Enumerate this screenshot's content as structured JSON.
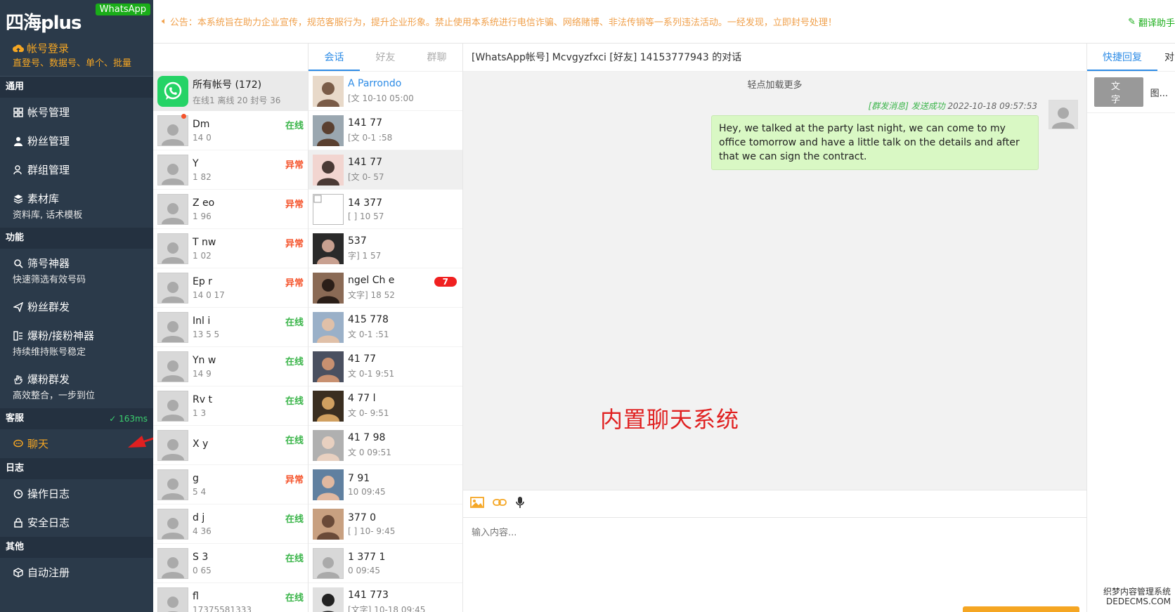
{
  "brand": {
    "title": "四海plus",
    "badge": "WhatsApp"
  },
  "sidebar": {
    "login": {
      "title": "帐号登录",
      "sub": "直登号、数据号、单个、批量"
    },
    "sections": [
      {
        "title": "通用",
        "extra": "",
        "items": [
          {
            "label": "帐号管理",
            "sub": "",
            "icon": "grid-icon"
          },
          {
            "label": "粉丝管理",
            "sub": "",
            "icon": "user-icon"
          },
          {
            "label": "群组管理",
            "sub": "",
            "icon": "group-icon"
          },
          {
            "label": "素材库",
            "sub": "资料库, 话术模板",
            "icon": "layers-icon"
          }
        ]
      },
      {
        "title": "功能",
        "extra": "",
        "items": [
          {
            "label": "筛号神器",
            "sub": "快速筛选有效号码",
            "icon": "search-icon"
          },
          {
            "label": "粉丝群发",
            "sub": "",
            "icon": "send-icon"
          },
          {
            "label": "爆粉/接粉神器",
            "sub": "持续维持账号稳定",
            "icon": "list-icon"
          },
          {
            "label": "爆粉群发",
            "sub": "高效整合，一步到位",
            "icon": "hand-icon"
          }
        ]
      },
      {
        "title": "客服",
        "extra": "✓ 163ms",
        "items": [
          {
            "label": "聊天",
            "sub": "",
            "icon": "chat-icon",
            "active": true
          }
        ]
      },
      {
        "title": "日志",
        "extra": "",
        "items": [
          {
            "label": "操作日志",
            "sub": "",
            "icon": "clock-icon"
          },
          {
            "label": "安全日志",
            "sub": "",
            "icon": "lock-icon"
          }
        ]
      },
      {
        "title": "其他",
        "extra": "",
        "items": [
          {
            "label": "自动注册",
            "sub": "",
            "icon": "cube-icon"
          }
        ]
      }
    ]
  },
  "notice": {
    "text": "公告：本系统旨在助力企业宣传，规范客服行为，提升企业形象。禁止使用本系统进行电信诈骗、网络赌博、非法传销等一系列违法活动。一经发现，立即封号处理！",
    "right": "翻译助手"
  },
  "accounts": {
    "all": {
      "title": "所有帐号 (172)",
      "sub": "在线1  离线 20 封号 36"
    },
    "rows": [
      {
        "name": "Dm",
        "num": "14          0",
        "status": "在线",
        "kind": "on",
        "dot": true
      },
      {
        "name": "Y",
        "num": "1          82",
        "status": "异常",
        "kind": "err"
      },
      {
        "name": "Z          eo",
        "num": "1          96",
        "status": "异常",
        "kind": "err"
      },
      {
        "name": "T          nw",
        "num": "1          02",
        "status": "异常",
        "kind": "err"
      },
      {
        "name": "Ep   r",
        "num": "14    0    17",
        "status": "异常",
        "kind": "err"
      },
      {
        "name": "Inl   i",
        "num": "13    5    5",
        "status": "在线",
        "kind": "on"
      },
      {
        "name": "Yn      w",
        "num": "14    9",
        "status": "在线",
        "kind": "on"
      },
      {
        "name": "Rv   t",
        "num": "1    3",
        "status": "在线",
        "kind": "on"
      },
      {
        "name": "X    y",
        "num": "",
        "status": "在线",
        "kind": "on"
      },
      {
        "name": "    g",
        "num": "    5    4",
        "status": "异常",
        "kind": "err"
      },
      {
        "name": "d    j",
        "num": "4    36",
        "status": "在线",
        "kind": "on"
      },
      {
        "name": "S    3",
        "num": "    0    65",
        "status": "在线",
        "kind": "on"
      },
      {
        "name": "    fl",
        "num": "17375581333",
        "status": "在线",
        "kind": "on"
      }
    ]
  },
  "convs": {
    "tabs": [
      "会话",
      "好友",
      "群聊"
    ],
    "rows": [
      {
        "name": "A    Parrondo",
        "sub": "[文    10-10 05:00",
        "link": true,
        "photo": "woman"
      },
      {
        "name": "141    77",
        "sub": "[文    0-1    :58",
        "photo": "man"
      },
      {
        "name": "141    77",
        "sub": "[文    0-    57",
        "photo": "child",
        "sel": true
      },
      {
        "name": "14    377",
        "sub": "[    ] 10    57",
        "photo": "broken"
      },
      {
        "name": "    537",
        "sub": "    字] 1    57",
        "photo": "dark"
      },
      {
        "name": "ngel    Ch    e",
        "sub": "文字]    18    52",
        "photo": "girl",
        "badge": "7"
      },
      {
        "name": "415    778",
        "sub": "文    0-1    :51",
        "photo": "oldman"
      },
      {
        "name": "41    77",
        "sub": "文    0-1    9:51",
        "photo": "group"
      },
      {
        "name": "4    77    l",
        "sub": "文    0-    9:51",
        "photo": "night"
      },
      {
        "name": "41    7    98",
        "sub": "文    0    09:51",
        "photo": "oldman2"
      },
      {
        "name": "    7    91",
        "sub": "    10    09:45",
        "photo": "glasses"
      },
      {
        "name": "    377    0",
        "sub": "[    ] 10-    9:45",
        "photo": "couple"
      },
      {
        "name": "1    377    1",
        "sub": "    0    09:45",
        "photo": "default"
      },
      {
        "name": "141    773",
        "sub": "[文字] 10-18 09:45",
        "photo": "cyclist"
      }
    ]
  },
  "chat": {
    "header": "[WhatsApp帐号] Mcvgyzfxci [好友] 14153777943 的对话",
    "load_more": "轻点加载更多",
    "meta_status": "[群发消息] 发送成功",
    "meta_time": "2022-10-18 09:57:53",
    "message": "Hey, we talked at the party last night, we can come to my office tomorrow and have a little talk on the details and after that we can sign the contract.",
    "watermark": "内置聊天系统",
    "input_placeholder": "输入内容..."
  },
  "quick": {
    "tabs": [
      "快捷回复",
      "对"
    ],
    "sub": [
      "文字",
      "图..."
    ]
  },
  "corner": {
    "line1": "织梦内容管理系统",
    "line2": "DEDECMS.COM"
  },
  "colors": {
    "sidebar": "#2b3a4a",
    "accent": "#f5a623",
    "online": "#3bb54a",
    "error": "#f5532b",
    "link": "#2e8ce6",
    "bubble": "#d9f8c4"
  }
}
